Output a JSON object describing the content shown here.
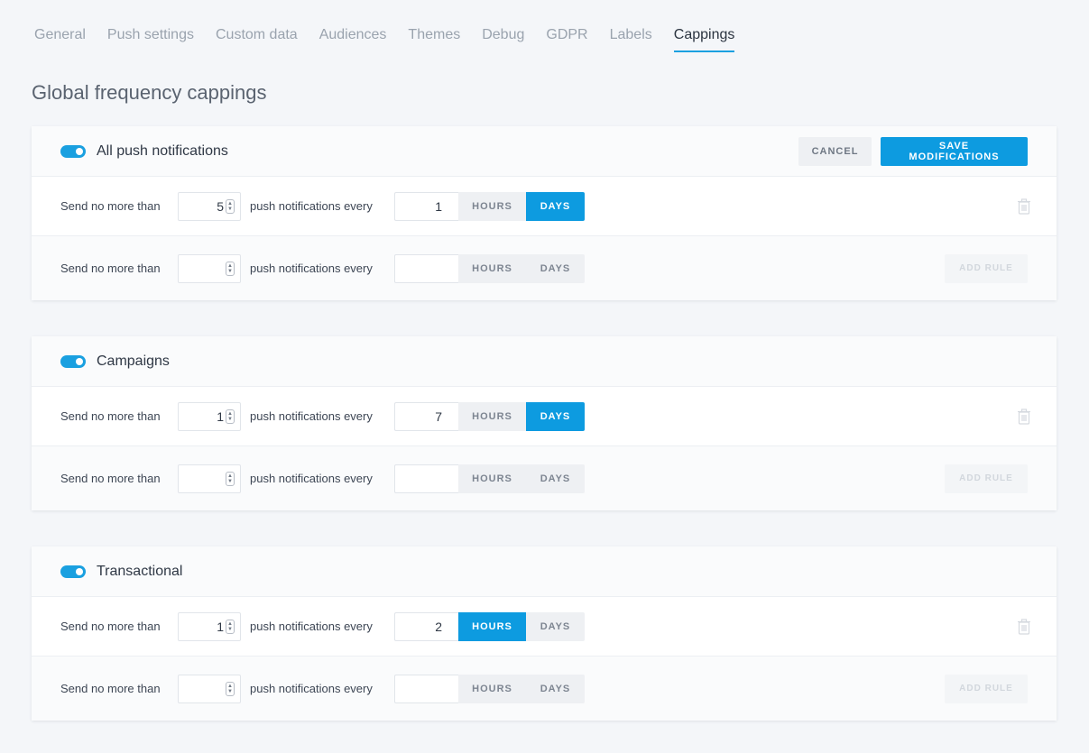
{
  "tabs": [
    {
      "label": "General"
    },
    {
      "label": "Push settings"
    },
    {
      "label": "Custom data"
    },
    {
      "label": "Audiences"
    },
    {
      "label": "Themes"
    },
    {
      "label": "Debug"
    },
    {
      "label": "GDPR"
    },
    {
      "label": "Labels"
    },
    {
      "label": "Cappings",
      "active": true
    }
  ],
  "page_title": "Global frequency cappings",
  "actions": {
    "cancel": "CANCEL",
    "save": "SAVE MODIFICATIONS"
  },
  "labels": {
    "send_no_more": "Send no more than",
    "notifications_every": "push notifications every",
    "hours": "HOURS",
    "days": "DAYS",
    "add_rule": "ADD RULE"
  },
  "colors": {
    "accent": "#0d9be0",
    "toggle": "#1aa0e0"
  },
  "cards": [
    {
      "title": "All push notifications",
      "enabled": true,
      "rule": {
        "count": "5",
        "period": "1",
        "unit": "days"
      }
    },
    {
      "title": "Campaigns",
      "enabled": true,
      "rule": {
        "count": "1",
        "period": "7",
        "unit": "days"
      }
    },
    {
      "title": "Transactional",
      "enabled": true,
      "rule": {
        "count": "1",
        "period": "2",
        "unit": "hours"
      }
    }
  ]
}
